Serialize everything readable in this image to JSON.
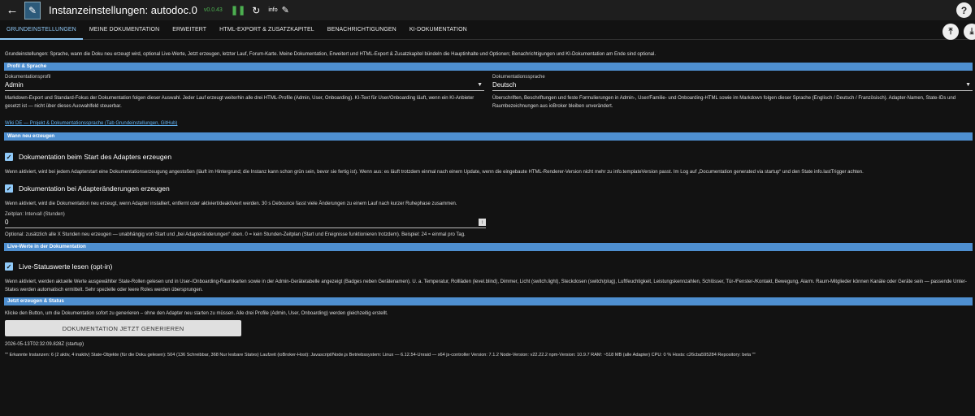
{
  "header": {
    "title": "Instanzeinstellungen: autodoc.0",
    "version": "v0.0.43",
    "info_label": "info",
    "help_symbol": "?"
  },
  "tabs": [
    {
      "label": "GRUNDEINSTELLUNGEN"
    },
    {
      "label": "MEINE DOKUMENTATION"
    },
    {
      "label": "ERWEITERT"
    },
    {
      "label": "HTML-EXPORT & ZUSATZKAPITEL"
    },
    {
      "label": "BENACHRICHTIGUNGEN"
    },
    {
      "label": "KI-DOKUMENTATION"
    }
  ],
  "intro": "Grundeinstellungen: Sprache, wann die Doku neu erzeugt wird, optional Live-Werte, Jetzt erzeugen, letzter Lauf, Forum-Karte. Meine Dokumentation, Erweitert und HTML-Export & Zusatzkapitel bündeln die Hauptinhalte und Optionen; Benachrichtigungen und KI-Dokumentation am Ende sind optional.",
  "sections": {
    "profil": {
      "title": "Profil & Sprache",
      "profile_label": "Dokumentationsprofil",
      "profile_value": "Admin",
      "profile_help": "Markdown-Export und Standard-Fokus der Dokumentation folgen dieser Auswahl. Jeder Lauf erzeugt weiterhin alle drei HTML-Profile (Admin, User, Onboarding). KI-Text für User/Onboarding läuft, wenn ein KI-Anbieter gesetzt ist — nicht über dieses Auswahlfeld steuerbar.",
      "lang_label": "Dokumentationssprache",
      "lang_value": "Deutsch",
      "lang_help": "Überschriften, Beschriftungen und feste Formulierungen in Admin-, User/Familie- und Onboarding-HTML sowie im Markdown folgen dieser Sprache (Englisch / Deutsch / Französisch). Adapter-Namen, State-IDs und Raumbezeichnungen aus ioBroker bleiben unverändert.",
      "wiki_link": "Wiki DE — Projekt & Dokumentationssprache (Tab Grundeinstellungen, GitHub)"
    },
    "wann": {
      "title": "Wann neu erzeugen",
      "check1_label": "Dokumentation beim Start des Adapters erzeugen",
      "check1_help": "Wenn aktiviert, wird bei jedem Adapterstart eine Dokumentationserzeugung angestoßen (läuft im Hintergrund; die Instanz kann schon grün sein, bevor sie fertig ist). Wenn aus: es läuft trotzdem einmal nach einem Update, wenn die eingebaute HTML-Renderer-Version nicht mehr zu info.templateVersion passt. Im Log auf „Documentation generated via startup“ und den State info.lastTrigger achten.",
      "check2_label": "Dokumentation bei Adapteränderungen erzeugen",
      "check2_help": "Wenn aktiviert, wird die Dokumentation neu erzeugt, wenn Adapter installiert, entfernt oder aktiviert/deaktiviert werden. 30 s Debounce fasst viele Änderungen zu einem Lauf nach kurzer Ruhephase zusammen.",
      "interval_label": "Zeitplan: Intervall (Stunden)",
      "interval_value": "0",
      "interval_help": "Optional: zusätzlich alle X Stunden neu erzeugen — unabhängig von Start und „bei Adapteränderungen“ oben. 0 = kein Stunden-Zeitplan (Start und Ereignisse funktionieren trotzdem). Beispiel: 24 ≈ einmal pro Tag."
    },
    "live": {
      "title": "Live-Werte in der Dokumentation",
      "check_label": "Live-Statuswerte lesen (opt-in)",
      "help": "Wenn aktiviert, werden aktuelle Werte ausgewählter State-Rollen gelesen und in User-/Onboarding-Raumkarten sowie in der Admin-Gerätetabelle angezeigt (Badges neben Gerätenamen). U. a. Temperatur, Rollläden (level.blind), Dimmer, Licht (switch.light), Steckdosen (switch/plug), Luftfeuchtigkeit, Leistungskennzahlen, Schlösser, Tür-/Fenster-/Kontakt, Bewegung, Alarm. Raum-Mitglieder können Kanäle oder Geräte sein — passende Unter-States werden automatisch ermittelt. Sehr spezielle oder leere Roles werden übersprungen."
    },
    "jetzt": {
      "title": "Jetzt erzeugen & Status",
      "help": "Klicke den Button, um die Dokumentation sofort zu generieren – ohne den Adapter neu starten zu müssen. Alle drei Profile (Admin, User, Onboarding) werden gleichzeitig erstellt.",
      "button_label": "DOKUMENTATION JETZT GENERIEREN",
      "last_run": "2026-05-13T02:32:09.828Z (startup)",
      "stats": "\"\" Erkannte Instanzen: 6 (2 aktiv, 4 inaktiv) State-Objekte (für die Doku gelesen): 504 (136 Schreibbar, 368 Nur lesbare States) Laufzeit (ioBroker-Host): Javascript/Node.js Betriebssystem: Linux — 6.12.54-Unraid — x64 js-controller Version: 7.1.2 Node-Version: v22.22.2 npm-Version: 10.9.7 RAM: ~518 MB (alle Adapter) CPU: 0 % Hosts: c26cba595284 Repository: beta \"\""
    }
  }
}
